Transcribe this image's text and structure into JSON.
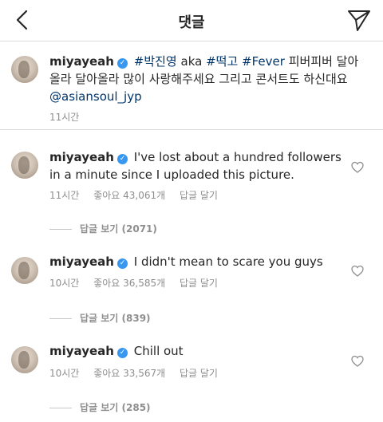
{
  "header": {
    "title": "댓글",
    "back_icon": "chevron-left-icon",
    "send_icon": "paper-plane-icon"
  },
  "caption": {
    "username": "miyayeah",
    "text_parts": [
      "#박진영",
      "aka",
      "#떡고",
      "#Fever",
      "피버피버 달아올라 달아올라 많이 사랑해주세요 그리고 콘서트도 하신대요",
      "@asiansoul_jyp"
    ],
    "time": "11시간"
  },
  "comments": [
    {
      "username": "miyayeah",
      "text": "I've lost about a hundred followers in a minute since I uploaded this picture.",
      "time": "11시간",
      "likes": "좋아요 43,061개",
      "reply": "답글 달기",
      "view_replies": "답글 보기 (2071)"
    },
    {
      "username": "miyayeah",
      "text": "I didn't mean to scare you guys",
      "time": "10시간",
      "likes": "좋아요 36,585개",
      "reply": "답글 달기",
      "view_replies": "답글 보기 (839)"
    },
    {
      "username": "miyayeah",
      "text": "Chill out",
      "time": "10시간",
      "likes": "좋아요 33,567개",
      "reply": "답글 달기",
      "view_replies": "답글 보기 (285)"
    }
  ],
  "colors": {
    "verified": "#3897f0",
    "link": "#003569",
    "muted": "#8e8e8e"
  }
}
